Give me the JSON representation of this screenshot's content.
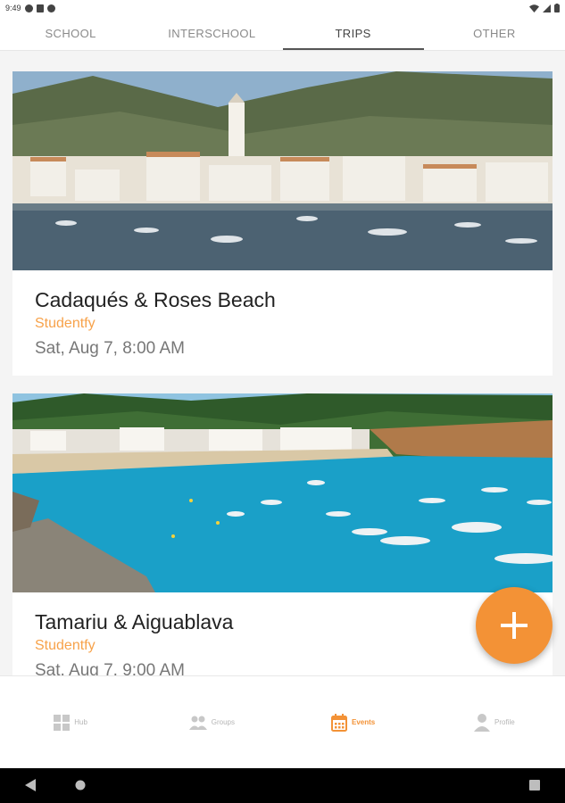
{
  "status_bar": {
    "time": "9:49"
  },
  "tabs": [
    {
      "label": "SCHOOL"
    },
    {
      "label": "INTERSCHOOL"
    },
    {
      "label": "TRIPS"
    },
    {
      "label": "OTHER"
    }
  ],
  "active_tab": "TRIPS",
  "events": [
    {
      "title": "Cadaqués & Roses Beach",
      "organizer": "Studentfy",
      "date": "Sat, Aug 7, 8:00 AM"
    },
    {
      "title": "Tamariu & Aiguablava",
      "organizer": "Studentfy",
      "date": "Sat, Aug 7, 9:00 AM"
    }
  ],
  "fab": {
    "icon": "plus-icon"
  },
  "bottom_nav": [
    {
      "label": "Hub",
      "icon": "grid-icon"
    },
    {
      "label": "Groups",
      "icon": "people-icon"
    },
    {
      "label": "Events",
      "icon": "calendar-icon"
    },
    {
      "label": "Profile",
      "icon": "person-icon"
    }
  ],
  "active_nav": "Events",
  "colors": {
    "accent": "#f39236",
    "organizer": "#f7a24a"
  }
}
